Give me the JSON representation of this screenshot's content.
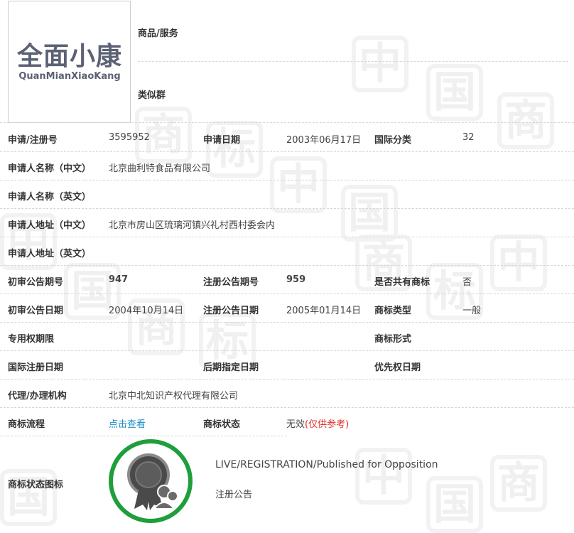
{
  "header": {
    "goods_label": "商品/服务",
    "similar_label": "类似群",
    "logo": {
      "main": "全面小康",
      "sub": "QuanMianXiaoKang"
    }
  },
  "rows": {
    "reg_no": {
      "label": "申请/注册号",
      "value": "3595952"
    },
    "app_date": {
      "label": "申请日期",
      "value": "2003年06月17日"
    },
    "intl_class": {
      "label": "国际分类",
      "value": "32"
    },
    "applicant_cn": {
      "label": "申请人名称（中文）",
      "value": "北京曲利特食品有限公司"
    },
    "applicant_en": {
      "label": "申请人名称（英文）",
      "value": ""
    },
    "address_cn": {
      "label": "申请人地址（中文）",
      "value": "北京市房山区琉璃河镇兴礼村西村委会内"
    },
    "address_en": {
      "label": "申请人地址（英文）",
      "value": ""
    },
    "prelim_issue": {
      "label": "初审公告期号",
      "value": "947"
    },
    "reg_issue": {
      "label": "注册公告期号",
      "value": "959"
    },
    "shared": {
      "label": "是否共有商标",
      "value": "否"
    },
    "prelim_date": {
      "label": "初审公告日期",
      "value": "2004年10月14日"
    },
    "reg_date": {
      "label": "注册公告日期",
      "value": "2005年01月14日"
    },
    "tm_type": {
      "label": "商标类型",
      "value": "一般"
    },
    "exclusive": {
      "label": "专用权期限",
      "value": ""
    },
    "tm_form": {
      "label": "商标形式",
      "value": ""
    },
    "intl_reg_date": {
      "label": "国际注册日期",
      "value": ""
    },
    "later_date": {
      "label": "后期指定日期",
      "value": ""
    },
    "priority_date": {
      "label": "优先权日期",
      "value": ""
    },
    "agent": {
      "label": "代理/办理机构",
      "value": "北京中北知识产权代理有限公司"
    },
    "process": {
      "label": "商标流程",
      "value": "点击查看"
    },
    "status": {
      "label": "商标状态",
      "value": "无效",
      "note": "(仅供参考)"
    },
    "status_icon": {
      "label": "商标状态图标",
      "en": "LIVE/REGISTRATION/Published for Opposition",
      "cn": "注册公告"
    }
  },
  "watermark": [
    "中",
    "国",
    "商",
    "标"
  ],
  "colors": {
    "link": "#1a8fc9",
    "red": "#e0302a",
    "badge_ring": "#1e9e3c"
  },
  "icons": {
    "status_badge": "registration-badge-icon"
  }
}
